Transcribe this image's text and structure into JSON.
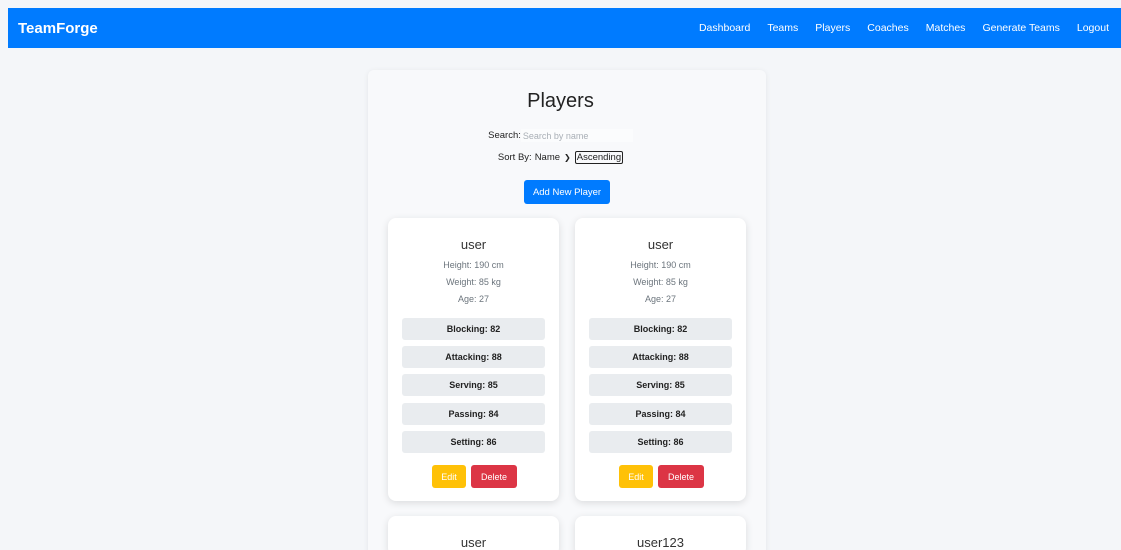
{
  "navbar": {
    "brand": "TeamForge",
    "links": [
      "Dashboard",
      "Teams",
      "Players",
      "Coaches",
      "Matches",
      "Generate Teams",
      "Logout"
    ]
  },
  "page": {
    "title": "Players",
    "search_label": "Search:",
    "search_placeholder": "Search by name",
    "sort_label": "Sort By:",
    "sort_value": "Name",
    "order_value": "Ascending",
    "add_button": "Add New Player"
  },
  "players": [
    {
      "name": "user",
      "height": "Height: 190 cm",
      "weight": "Weight: 85 kg",
      "age": "Age: 27",
      "stats": [
        "Blocking: 82",
        "Attacking: 88",
        "Serving: 85",
        "Passing: 84",
        "Setting: 86"
      ],
      "edit": "Edit",
      "delete": "Delete"
    },
    {
      "name": "user",
      "height": "Height: 190 cm",
      "weight": "Weight: 85 kg",
      "age": "Age: 27",
      "stats": [
        "Blocking: 82",
        "Attacking: 88",
        "Serving: 85",
        "Passing: 84",
        "Setting: 86"
      ],
      "edit": "Edit",
      "delete": "Delete"
    },
    {
      "name": "user"
    },
    {
      "name": "user123"
    }
  ]
}
